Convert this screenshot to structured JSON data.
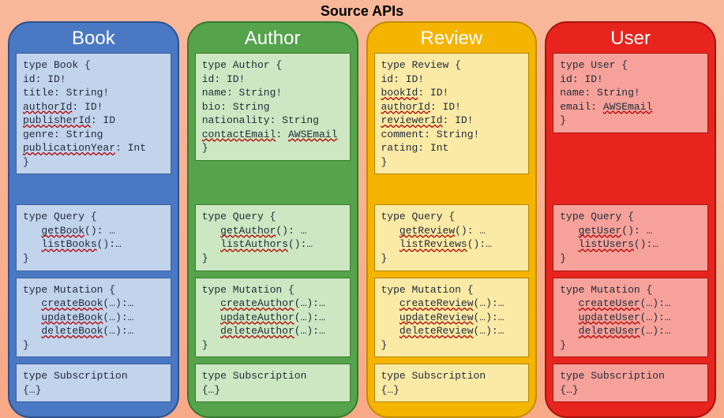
{
  "title": "Source APIs",
  "columns": [
    {
      "key": "book",
      "header": "Book",
      "typeDef": "type Book {\nid: ID!\ntitle: String!\nauthorId: ID!\npublisherId: ID\ngenre: String\npublicationYear: Int\n}",
      "query": "type Query {\n   getBook(): …\n   listBooks():…\n}",
      "mutation": "type Mutation {\n   createBook(…):…\n   updateBook(…):…\n   deleteBook(…):…\n}",
      "subscription": "type Subscription\n{…}"
    },
    {
      "key": "author",
      "header": "Author",
      "typeDef": "type Author {\nid: ID!\nname: String!\nbio: String\nnationality: String\ncontactEmail: AWSEmail\n}",
      "query": "type Query {\n   getAuthor(): …\n   listAuthors():…\n}",
      "mutation": "type Mutation {\n   createAuthor(…):…\n   updateAuthor(…):…\n   deleteAuthor(…):…\n}",
      "subscription": "type Subscription\n{…}"
    },
    {
      "key": "review",
      "header": "Review",
      "typeDef": "type Review {\nid: ID!\nbookId: ID!\nauthorId: ID!\nreviewerId: ID!\ncomment: String!\nrating: Int\n}",
      "query": "type Query {\n   getReview(): …\n   listReviews():…\n}",
      "mutation": "type Mutation {\n   createReview(…):…\n   updateReview(…):…\n   deleteReview(…):…\n}",
      "subscription": "type Subscription\n{…}"
    },
    {
      "key": "user",
      "header": "User",
      "typeDef": "type User {\nid: ID!\nname: String!\nemail: AWSEmail\n}",
      "query": "type Query {\n   getUser(): …\n   listUsers():…\n}",
      "mutation": "type Mutation {\n   createUser(…):…\n   updateUser(…):…\n   deleteUser(…):…\n}",
      "subscription": "type Subscription\n{…}"
    }
  ]
}
